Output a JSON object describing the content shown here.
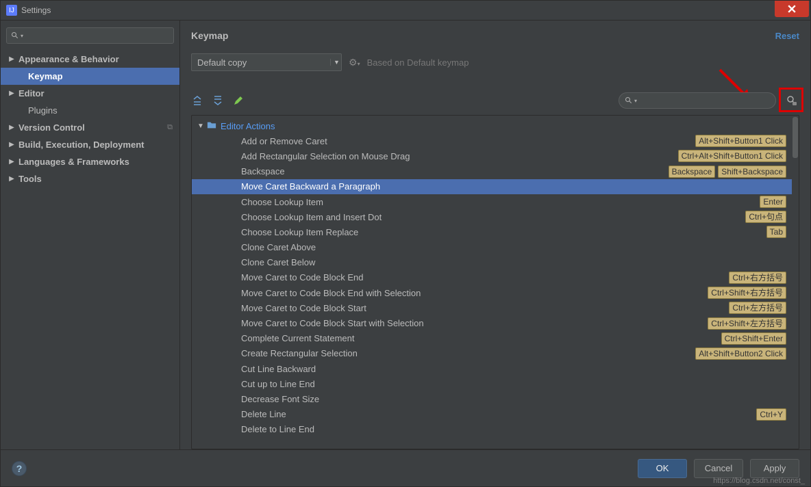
{
  "window": {
    "title": "Settings"
  },
  "sidebar": {
    "items": [
      {
        "label": "Appearance & Behavior",
        "arrow": true,
        "bold": true
      },
      {
        "label": "Keymap",
        "indent": true,
        "selected": true,
        "bold": true
      },
      {
        "label": "Editor",
        "arrow": true,
        "bold": true
      },
      {
        "label": "Plugins",
        "indent": true
      },
      {
        "label": "Version Control",
        "arrow": true,
        "bold": true,
        "copy": true
      },
      {
        "label": "Build, Execution, Deployment",
        "arrow": true,
        "bold": true
      },
      {
        "label": "Languages & Frameworks",
        "arrow": true,
        "bold": true
      },
      {
        "label": "Tools",
        "arrow": true,
        "bold": true
      }
    ]
  },
  "main": {
    "title": "Keymap",
    "reset": "Reset",
    "scheme": "Default copy",
    "based_on": "Based on Default keymap"
  },
  "tree": {
    "group": "Editor Actions",
    "actions": [
      {
        "label": "Add or Remove Caret",
        "shortcuts": [
          "Alt+Shift+Button1 Click"
        ]
      },
      {
        "label": "Add Rectangular Selection on Mouse Drag",
        "shortcuts": [
          "Ctrl+Alt+Shift+Button1 Click"
        ]
      },
      {
        "label": "Backspace",
        "shortcuts": [
          "Backspace",
          "Shift+Backspace"
        ]
      },
      {
        "label": "Move Caret Backward a Paragraph",
        "shortcuts": [],
        "selected": true
      },
      {
        "label": "Choose Lookup Item",
        "shortcuts": [
          "Enter"
        ]
      },
      {
        "label": "Choose Lookup Item and Insert Dot",
        "shortcuts": [
          "Ctrl+句点"
        ]
      },
      {
        "label": "Choose Lookup Item Replace",
        "shortcuts": [
          "Tab"
        ]
      },
      {
        "label": "Clone Caret Above",
        "shortcuts": []
      },
      {
        "label": "Clone Caret Below",
        "shortcuts": []
      },
      {
        "label": "Move Caret to Code Block End",
        "shortcuts": [
          "Ctrl+右方括号"
        ]
      },
      {
        "label": "Move Caret to Code Block End with Selection",
        "shortcuts": [
          "Ctrl+Shift+右方括号"
        ]
      },
      {
        "label": "Move Caret to Code Block Start",
        "shortcuts": [
          "Ctrl+左方括号"
        ]
      },
      {
        "label": "Move Caret to Code Block Start with Selection",
        "shortcuts": [
          "Ctrl+Shift+左方括号"
        ]
      },
      {
        "label": "Complete Current Statement",
        "shortcuts": [
          "Ctrl+Shift+Enter"
        ]
      },
      {
        "label": "Create Rectangular Selection",
        "shortcuts": [
          "Alt+Shift+Button2 Click"
        ]
      },
      {
        "label": "Cut Line Backward",
        "shortcuts": []
      },
      {
        "label": "Cut up to Line End",
        "shortcuts": []
      },
      {
        "label": "Decrease Font Size",
        "shortcuts": []
      },
      {
        "label": "Delete Line",
        "shortcuts": [
          "Ctrl+Y"
        ]
      },
      {
        "label": "Delete to Line End",
        "shortcuts": []
      }
    ]
  },
  "footer": {
    "ok": "OK",
    "cancel": "Cancel",
    "apply": "Apply"
  },
  "watermark": "https://blog.csdn.net/const_"
}
